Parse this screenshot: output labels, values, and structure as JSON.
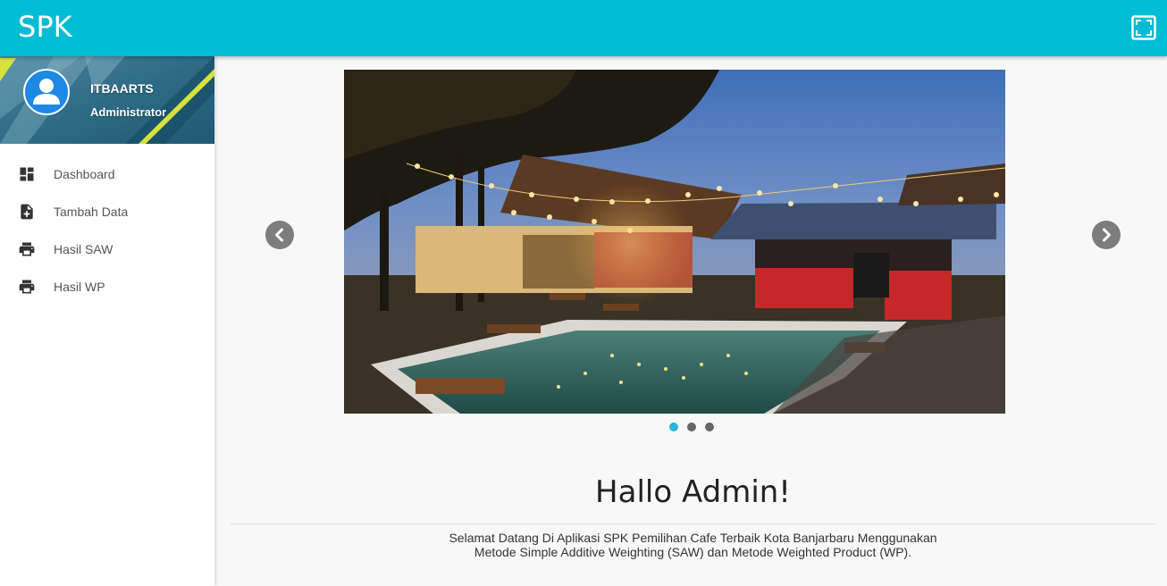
{
  "app": {
    "brand": "SPK"
  },
  "topbar": {
    "fullscreen_icon": "fullscreen-icon"
  },
  "user": {
    "name": "ITBAARTS",
    "role": "Administrator",
    "avatar_icon": "person-icon"
  },
  "sidebar": {
    "items": [
      {
        "label": "Dashboard",
        "icon": "dashboard-icon"
      },
      {
        "label": "Tambah Data",
        "icon": "note-add-icon"
      },
      {
        "label": "Hasil SAW",
        "icon": "print-icon"
      },
      {
        "label": "Hasil WP",
        "icon": "print-icon"
      }
    ]
  },
  "carousel": {
    "slide_count": 3,
    "active_index": 0,
    "prev_icon": "chevron-left-icon",
    "next_icon": "chevron-right-icon"
  },
  "content": {
    "greeting": "Hallo Admin!",
    "welcome_line1": "Selamat Datang Di Aplikasi SPK Pemilihan Cafe Terbaik Kota Banjarbaru Menggunakan",
    "welcome_line2": "Metode Simple Additive Weighting (SAW) dan Metode Weighted Product (WP)."
  },
  "colors": {
    "primary": "#00bcd4",
    "indicator_active": "#29b6d8"
  }
}
